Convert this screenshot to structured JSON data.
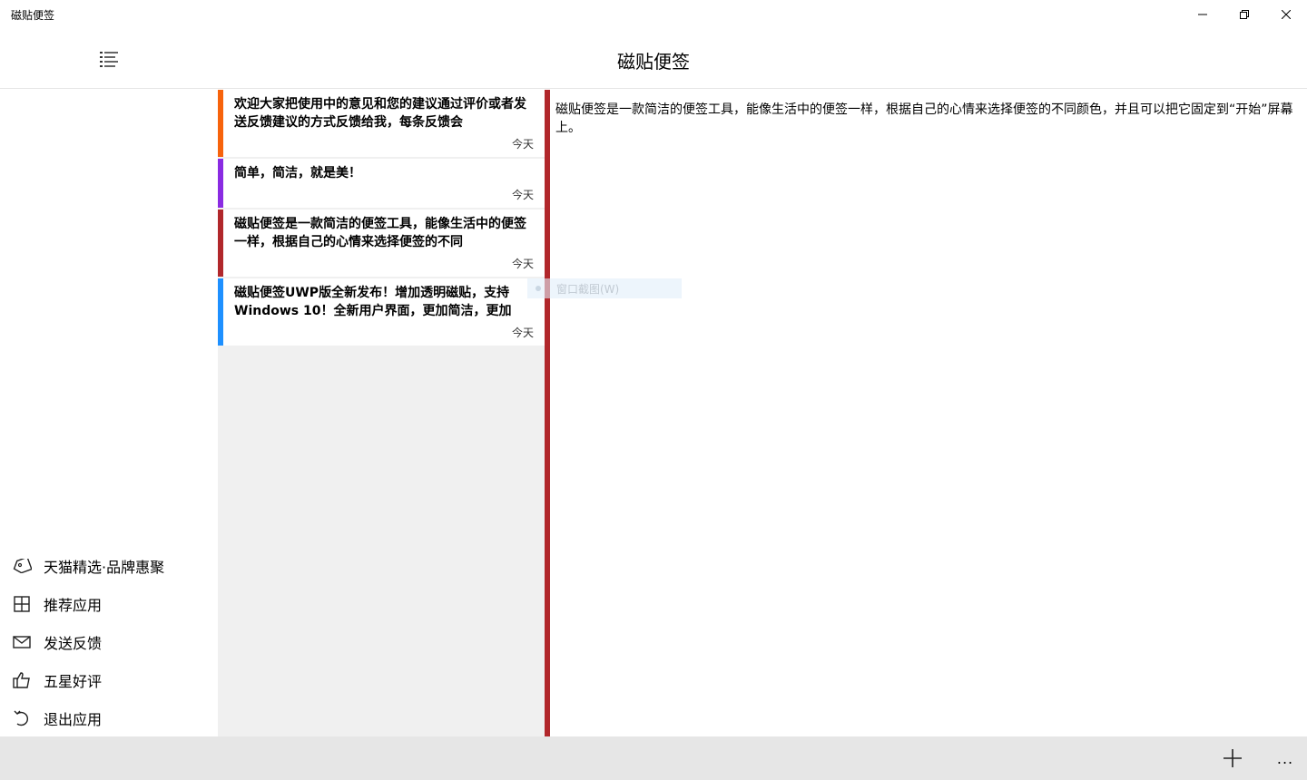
{
  "window": {
    "title": "磁贴便签"
  },
  "header": {
    "title": "磁贴便签"
  },
  "sidebar": {
    "items": [
      {
        "label": "天猫精选·品牌惠聚",
        "icon": "tag-icon"
      },
      {
        "label": "推荐应用",
        "icon": "grid-icon"
      },
      {
        "label": "发送反馈",
        "icon": "mail-icon"
      },
      {
        "label": "五星好评",
        "icon": "thumbs-up-icon"
      },
      {
        "label": "退出应用",
        "icon": "exit-icon"
      }
    ]
  },
  "notes": [
    {
      "text": "欢迎大家把使用中的意见和您的建议通过评价或者发送反馈建议的方式反馈给我，每条反馈会",
      "date": "今天",
      "color": "#f7630c"
    },
    {
      "text": "简单，简洁，就是美！",
      "date": "今天",
      "color": "#8a2be2"
    },
    {
      "text": "磁贴便签是一款简洁的便签工具，能像生活中的便签一样，根据自己的心情来选择便签的不同",
      "date": "今天",
      "color": "#b1272b"
    },
    {
      "text": "磁贴便签UWP版全新发布！增加透明磁贴，支持Windows 10！全新用户界面，更加简洁，更加",
      "date": "今天",
      "color": "#1e90ff"
    }
  ],
  "editor": {
    "text": "磁贴便签是一款简洁的便签工具，能像生活中的便签一样，根据自己的心情来选择便签的不同颜色，并且可以把它固定到“开始”屏幕上。",
    "accent": "#b1272b"
  },
  "ghost_tooltip": {
    "label": "窗口截图(W)"
  },
  "commands": {
    "add": "add-icon",
    "more": "..."
  }
}
